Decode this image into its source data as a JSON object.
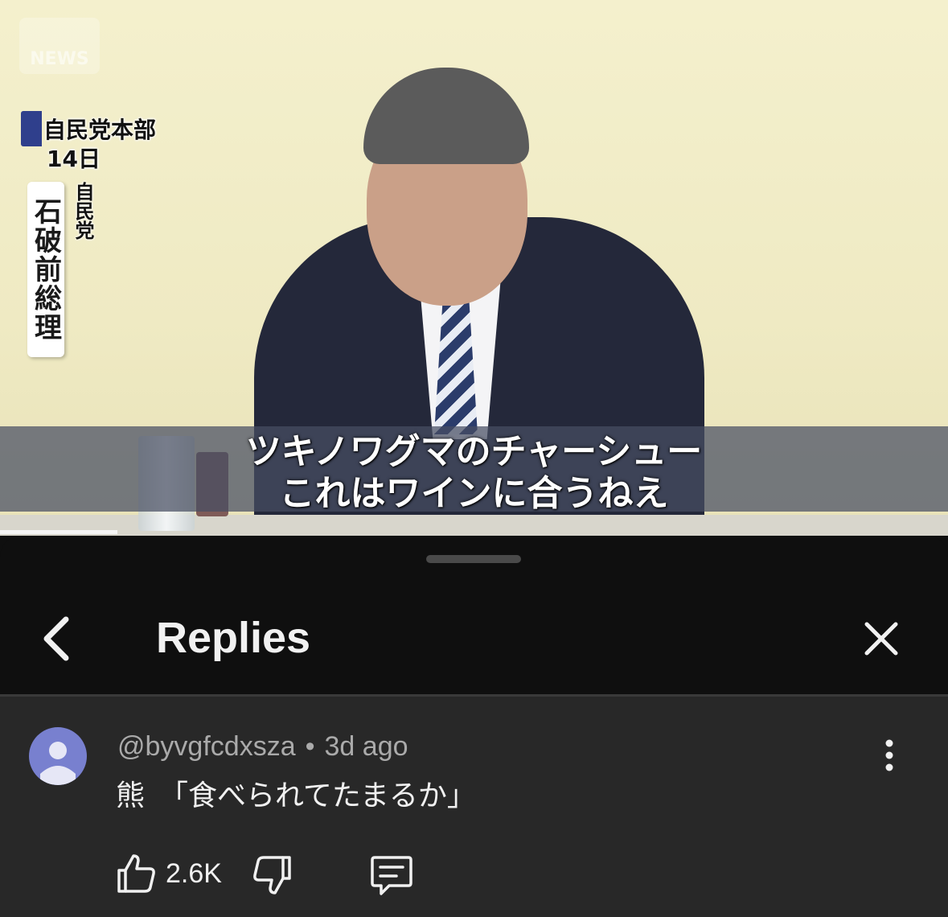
{
  "video": {
    "channel_logo": "NEWS",
    "location": "自民党本部",
    "date": "14日",
    "speaker_name": "石破前総理",
    "speaker_party": "自民党",
    "caption_line1": "ツキノワグマのチャーシュー",
    "caption_line2": "これはワインに合うねえ",
    "progress_fraction": 0.124
  },
  "header": {
    "title": "Replies",
    "back_icon": "chevron-left-icon",
    "close_icon": "close-icon"
  },
  "comment": {
    "author": "@byvgfcdxsza",
    "separator": "•",
    "time": "3d ago",
    "text": "熊　「食べられてたまるか」",
    "likes": "2.6K",
    "avatar_color": "#7880cf"
  },
  "colors": {
    "background": "#0f0f0f",
    "comment_bg": "#282828",
    "text_primary": "#f1f1f1",
    "text_secondary": "#aaaaaa"
  }
}
